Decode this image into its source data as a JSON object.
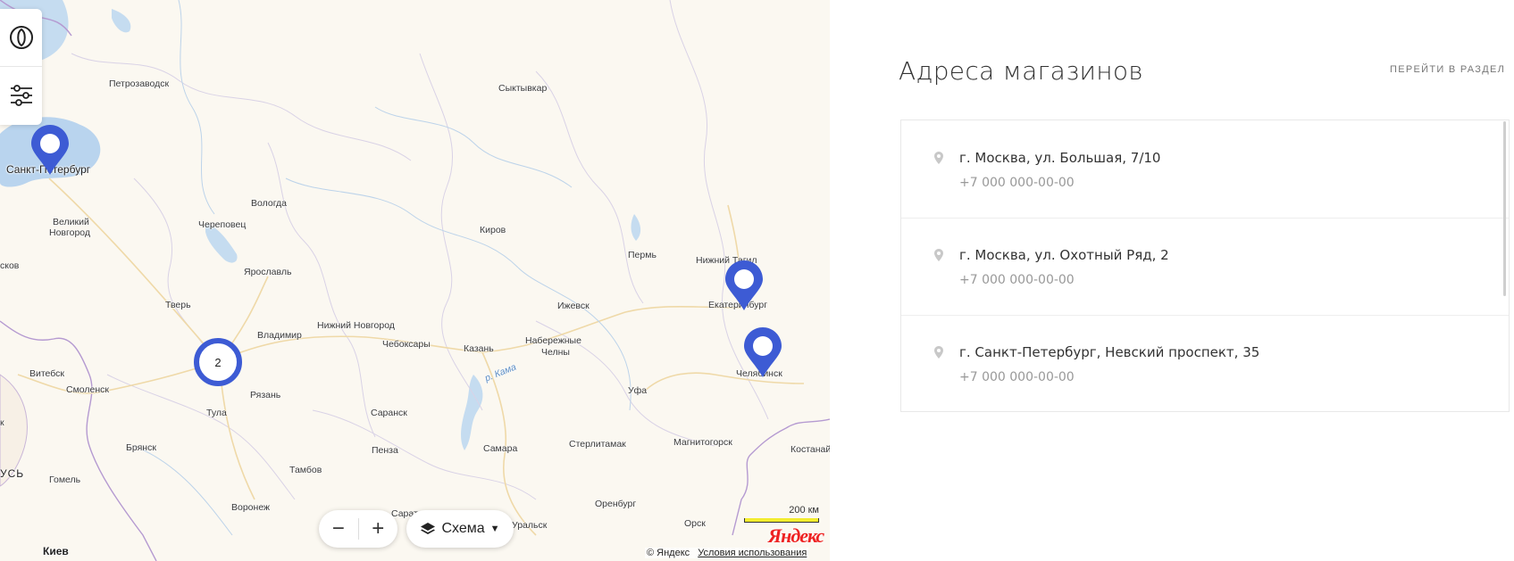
{
  "map": {
    "cities": [
      {
        "name": "Петрозаводск"
      },
      {
        "name": "Сыктывкар"
      },
      {
        "name": "Санкт-Петербург"
      },
      {
        "name": "Вологда"
      },
      {
        "name": "Великий"
      },
      {
        "name": "Новгород"
      },
      {
        "name": "Череповец"
      },
      {
        "name": "Киров"
      },
      {
        "name": "Пермь"
      },
      {
        "name": "Нижний Тагил"
      },
      {
        "name": "Ярославль"
      },
      {
        "name": "Тверь"
      },
      {
        "name": "Ижевск"
      },
      {
        "name": "Екатеринбург"
      },
      {
        "name": "Нижний Новгород"
      },
      {
        "name": "Владимир"
      },
      {
        "name": "Чебоксары"
      },
      {
        "name": "Казань"
      },
      {
        "name": "Набережные"
      },
      {
        "name": "Челны"
      },
      {
        "name": "Челябинск"
      },
      {
        "name": "Витебск"
      },
      {
        "name": "Смоленск"
      },
      {
        "name": "Рязань"
      },
      {
        "name": "Уфа"
      },
      {
        "name": "Тула"
      },
      {
        "name": "Саранск"
      },
      {
        "name": "Стерлитамак"
      },
      {
        "name": "Магнитогорск"
      },
      {
        "name": "Брянск"
      },
      {
        "name": "Пенза"
      },
      {
        "name": "Самара"
      },
      {
        "name": "Костанай"
      },
      {
        "name": "Гомель"
      },
      {
        "name": "Тамбов"
      },
      {
        "name": "Воронеж"
      },
      {
        "name": "Саратов"
      },
      {
        "name": "Оренбург"
      },
      {
        "name": "Уральск"
      },
      {
        "name": "Орск"
      },
      {
        "name": "Киев"
      },
      {
        "name": "сков"
      },
      {
        "name": "УСЬ"
      },
      {
        "name": "к"
      },
      {
        "name": "р. Кама"
      }
    ],
    "cluster_count": "2",
    "layers_label": "Схема",
    "scale_label": "200 км",
    "logo": "Яндекс",
    "copyright": "© Яндекс",
    "terms_link": "Условия использования",
    "pin_color": "#3d5bd4"
  },
  "panel": {
    "title": "Адреса магазинов",
    "link": "ПЕРЕЙТИ В РАЗДЕЛ",
    "stores": [
      {
        "address": "г. Москва, ул. Большая, 7/10",
        "phone": "+7 000 000-00-00"
      },
      {
        "address": "г. Москва, ул. Охотный Ряд, 2",
        "phone": "+7 000 000-00-00"
      },
      {
        "address": "г. Санкт-Петербург, Невский проспект, 35",
        "phone": "+7 000 000-00-00"
      }
    ]
  }
}
